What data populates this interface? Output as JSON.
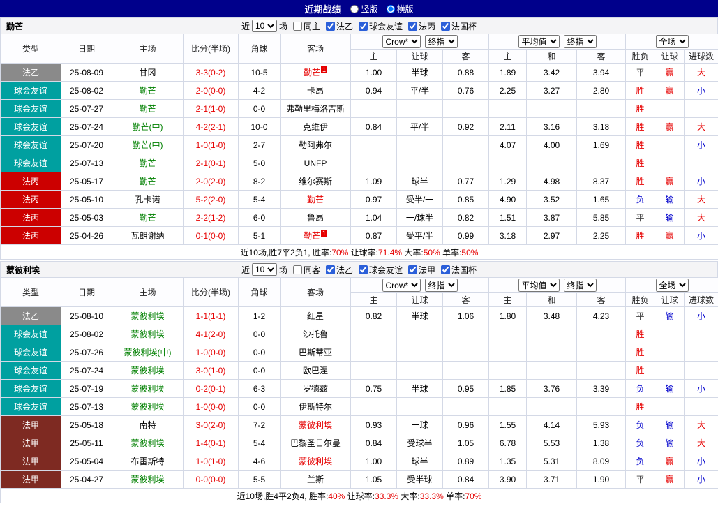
{
  "colors": {
    "topbar_bg": "#00008B",
    "red": "#E60000",
    "blue": "#0000CC",
    "green": "#008000",
    "dark": "#444444"
  },
  "topbar": {
    "title": "近期战绩",
    "options": [
      {
        "label": "竖版",
        "checked": false
      },
      {
        "label": "横版",
        "checked": true
      }
    ]
  },
  "shared": {
    "near_label": "近",
    "games_label": "场",
    "match_count": "10",
    "col_headers": [
      "类型",
      "日期",
      "主场",
      "比分(半场)",
      "角球",
      "客场"
    ],
    "sub_headers": [
      "主",
      "让球",
      "客",
      "主",
      "和",
      "客",
      "胜负",
      "让球",
      "进球数"
    ],
    "selects": {
      "asia_source": "Crow*",
      "asia_time": "终指",
      "europe_source": "平均值",
      "europe_time": "终指",
      "scope": "全场"
    },
    "league_colors": {
      "法乙": "#8A8A8A",
      "球会友谊": "#00A0A0",
      "法丙": "#CC0000",
      "法甲": "#7E2A22"
    }
  },
  "tables": [
    {
      "team": "勤芒",
      "filter": {
        "same_label": "同主",
        "same_checked": false,
        "leagues": [
          {
            "label": "法乙",
            "checked": true
          },
          {
            "label": "球会友谊",
            "checked": true
          },
          {
            "label": "法丙",
            "checked": true
          },
          {
            "label": "法国杯",
            "checked": true
          }
        ]
      },
      "rows": [
        {
          "league": "法乙",
          "date": "25-08-09",
          "home": {
            "name": "甘冈",
            "color": "black"
          },
          "score": "3-3(0-2)",
          "corner": "10-5",
          "away": {
            "name": "勤芒",
            "color": "red",
            "badge": "1"
          },
          "asia": [
            "1.00",
            "半球",
            "0.88"
          ],
          "europe": [
            "1.89",
            "3.42",
            "3.94"
          ],
          "results": [
            {
              "t": "平",
              "c": "dark"
            },
            {
              "t": "赢",
              "c": "red"
            },
            {
              "t": "大",
              "c": "red"
            }
          ]
        },
        {
          "league": "球会友谊",
          "date": "25-08-02",
          "home": {
            "name": "勤芒",
            "color": "green"
          },
          "score": "2-0(0-0)",
          "corner": "4-2",
          "away": {
            "name": "卡昂",
            "color": "black"
          },
          "asia": [
            "0.94",
            "平/半",
            "0.76"
          ],
          "europe": [
            "2.25",
            "3.27",
            "2.80"
          ],
          "results": [
            {
              "t": "胜",
              "c": "red"
            },
            {
              "t": "赢",
              "c": "red"
            },
            {
              "t": "小",
              "c": "blue"
            }
          ]
        },
        {
          "league": "球会友谊",
          "date": "25-07-27",
          "home": {
            "name": "勤芒",
            "color": "green"
          },
          "score": "2-1(1-0)",
          "corner": "0-0",
          "away": {
            "name": "弗勒里梅洛吉斯",
            "color": "black"
          },
          "asia": [
            "",
            "",
            ""
          ],
          "europe": [
            "",
            "",
            ""
          ],
          "results": [
            {
              "t": "胜",
              "c": "red"
            },
            {
              "t": ""
            },
            {
              "t": ""
            }
          ]
        },
        {
          "league": "球会友谊",
          "date": "25-07-24",
          "home": {
            "name": "勤芒(中)",
            "color": "green"
          },
          "score": "4-2(2-1)",
          "corner": "10-0",
          "away": {
            "name": "克维伊",
            "color": "black"
          },
          "asia": [
            "0.84",
            "平/半",
            "0.92"
          ],
          "europe": [
            "2.11",
            "3.16",
            "3.18"
          ],
          "results": [
            {
              "t": "胜",
              "c": "red"
            },
            {
              "t": "赢",
              "c": "red"
            },
            {
              "t": "大",
              "c": "red"
            }
          ]
        },
        {
          "league": "球会友谊",
          "date": "25-07-20",
          "home": {
            "name": "勤芒(中)",
            "color": "green"
          },
          "score": "1-0(1-0)",
          "corner": "2-7",
          "away": {
            "name": "勒阿弗尔",
            "color": "black"
          },
          "asia": [
            "",
            "",
            ""
          ],
          "europe": [
            "4.07",
            "4.00",
            "1.69"
          ],
          "results": [
            {
              "t": "胜",
              "c": "red"
            },
            {
              "t": ""
            },
            {
              "t": "小",
              "c": "blue"
            }
          ]
        },
        {
          "league": "球会友谊",
          "date": "25-07-13",
          "home": {
            "name": "勤芒",
            "color": "green"
          },
          "score": "2-1(0-1)",
          "corner": "5-0",
          "away": {
            "name": "UNFP",
            "color": "black"
          },
          "asia": [
            "",
            "",
            ""
          ],
          "europe": [
            "",
            "",
            ""
          ],
          "results": [
            {
              "t": "胜",
              "c": "red"
            },
            {
              "t": ""
            },
            {
              "t": ""
            }
          ]
        },
        {
          "league": "法丙",
          "date": "25-05-17",
          "home": {
            "name": "勤芒",
            "color": "green"
          },
          "score": "2-0(2-0)",
          "corner": "8-2",
          "away": {
            "name": "维尔赛斯",
            "color": "black"
          },
          "asia": [
            "1.09",
            "球半",
            "0.77"
          ],
          "europe": [
            "1.29",
            "4.98",
            "8.37"
          ],
          "results": [
            {
              "t": "胜",
              "c": "red"
            },
            {
              "t": "赢",
              "c": "red"
            },
            {
              "t": "小",
              "c": "blue"
            }
          ]
        },
        {
          "league": "法丙",
          "date": "25-05-10",
          "home": {
            "name": "孔卡诺",
            "color": "black"
          },
          "score": "5-2(2-0)",
          "corner": "5-4",
          "away": {
            "name": "勤芒",
            "color": "red"
          },
          "asia": [
            "0.97",
            "受半/一",
            "0.85"
          ],
          "europe": [
            "4.90",
            "3.52",
            "1.65"
          ],
          "results": [
            {
              "t": "负",
              "c": "blue"
            },
            {
              "t": "输",
              "c": "blue"
            },
            {
              "t": "大",
              "c": "red"
            }
          ]
        },
        {
          "league": "法丙",
          "date": "25-05-03",
          "home": {
            "name": "勤芒",
            "color": "green"
          },
          "score": "2-2(1-2)",
          "corner": "6-0",
          "away": {
            "name": "鲁昂",
            "color": "black"
          },
          "asia": [
            "1.04",
            "一/球半",
            "0.82"
          ],
          "europe": [
            "1.51",
            "3.87",
            "5.85"
          ],
          "results": [
            {
              "t": "平",
              "c": "dark"
            },
            {
              "t": "输",
              "c": "blue"
            },
            {
              "t": "大",
              "c": "red"
            }
          ]
        },
        {
          "league": "法丙",
          "date": "25-04-26",
          "home": {
            "name": "瓦朗谢纳",
            "color": "black"
          },
          "score": "0-1(0-0)",
          "corner": "5-1",
          "away": {
            "name": "勤芒",
            "color": "red",
            "badge": "1"
          },
          "asia": [
            "0.87",
            "受平/半",
            "0.99"
          ],
          "europe": [
            "3.18",
            "2.97",
            "2.25"
          ],
          "results": [
            {
              "t": "胜",
              "c": "red"
            },
            {
              "t": "赢",
              "c": "red"
            },
            {
              "t": "小",
              "c": "blue"
            }
          ]
        }
      ],
      "summary": [
        {
          "t": "近10场,胜7平2负1, 胜率:"
        },
        {
          "t": "70%",
          "c": "red"
        },
        {
          "t": " 让球率:"
        },
        {
          "t": "71.4%",
          "c": "red"
        },
        {
          "t": " 大率:"
        },
        {
          "t": "50%",
          "c": "red"
        },
        {
          "t": " 单率:"
        },
        {
          "t": "50%",
          "c": "red"
        }
      ]
    },
    {
      "team": "蒙彼利埃",
      "filter": {
        "same_label": "同客",
        "same_checked": false,
        "leagues": [
          {
            "label": "法乙",
            "checked": true
          },
          {
            "label": "球会友谊",
            "checked": true
          },
          {
            "label": "法甲",
            "checked": true
          },
          {
            "label": "法国杯",
            "checked": true
          }
        ]
      },
      "rows": [
        {
          "league": "法乙",
          "date": "25-08-10",
          "home": {
            "name": "蒙彼利埃",
            "color": "green"
          },
          "score": "1-1(1-1)",
          "corner": "1-2",
          "away": {
            "name": "红星",
            "color": "black"
          },
          "asia": [
            "0.82",
            "半球",
            "1.06"
          ],
          "europe": [
            "1.80",
            "3.48",
            "4.23"
          ],
          "results": [
            {
              "t": "平",
              "c": "dark"
            },
            {
              "t": "输",
              "c": "blue"
            },
            {
              "t": "小",
              "c": "blue"
            }
          ]
        },
        {
          "league": "球会友谊",
          "date": "25-08-02",
          "home": {
            "name": "蒙彼利埃",
            "color": "green"
          },
          "score": "4-1(2-0)",
          "corner": "0-0",
          "away": {
            "name": "沙托鲁",
            "color": "black"
          },
          "asia": [
            "",
            "",
            ""
          ],
          "europe": [
            "",
            "",
            ""
          ],
          "results": [
            {
              "t": "胜",
              "c": "red"
            },
            {
              "t": ""
            },
            {
              "t": ""
            }
          ]
        },
        {
          "league": "球会友谊",
          "date": "25-07-26",
          "home": {
            "name": "蒙彼利埃(中)",
            "color": "green"
          },
          "score": "1-0(0-0)",
          "corner": "0-0",
          "away": {
            "name": "巴斯蒂亚",
            "color": "black"
          },
          "asia": [
            "",
            "",
            ""
          ],
          "europe": [
            "",
            "",
            ""
          ],
          "results": [
            {
              "t": "胜",
              "c": "red"
            },
            {
              "t": ""
            },
            {
              "t": ""
            }
          ]
        },
        {
          "league": "球会友谊",
          "date": "25-07-24",
          "home": {
            "name": "蒙彼利埃",
            "color": "green"
          },
          "score": "3-0(1-0)",
          "corner": "0-0",
          "away": {
            "name": "欧巴涅",
            "color": "black"
          },
          "asia": [
            "",
            "",
            ""
          ],
          "europe": [
            "",
            "",
            ""
          ],
          "results": [
            {
              "t": "胜",
              "c": "red"
            },
            {
              "t": ""
            },
            {
              "t": ""
            }
          ]
        },
        {
          "league": "球会友谊",
          "date": "25-07-19",
          "home": {
            "name": "蒙彼利埃",
            "color": "green"
          },
          "score": "0-2(0-1)",
          "corner": "6-3",
          "away": {
            "name": "罗德兹",
            "color": "black"
          },
          "asia": [
            "0.75",
            "半球",
            "0.95"
          ],
          "europe": [
            "1.85",
            "3.76",
            "3.39"
          ],
          "results": [
            {
              "t": "负",
              "c": "blue"
            },
            {
              "t": "输",
              "c": "blue"
            },
            {
              "t": "小",
              "c": "blue"
            }
          ]
        },
        {
          "league": "球会友谊",
          "date": "25-07-13",
          "home": {
            "name": "蒙彼利埃",
            "color": "green"
          },
          "score": "1-0(0-0)",
          "corner": "0-0",
          "away": {
            "name": "伊斯特尔",
            "color": "black"
          },
          "asia": [
            "",
            "",
            ""
          ],
          "europe": [
            "",
            "",
            ""
          ],
          "results": [
            {
              "t": "胜",
              "c": "red"
            },
            {
              "t": ""
            },
            {
              "t": ""
            }
          ]
        },
        {
          "league": "法甲",
          "date": "25-05-18",
          "home": {
            "name": "南特",
            "color": "black"
          },
          "score": "3-0(2-0)",
          "corner": "7-2",
          "away": {
            "name": "蒙彼利埃",
            "color": "red"
          },
          "asia": [
            "0.93",
            "一球",
            "0.96"
          ],
          "europe": [
            "1.55",
            "4.14",
            "5.93"
          ],
          "results": [
            {
              "t": "负",
              "c": "blue"
            },
            {
              "t": "输",
              "c": "blue"
            },
            {
              "t": "大",
              "c": "red"
            }
          ]
        },
        {
          "league": "法甲",
          "date": "25-05-11",
          "home": {
            "name": "蒙彼利埃",
            "color": "green"
          },
          "score": "1-4(0-1)",
          "corner": "5-4",
          "away": {
            "name": "巴黎圣日尔曼",
            "color": "black"
          },
          "asia": [
            "0.84",
            "受球半",
            "1.05"
          ],
          "europe": [
            "6.78",
            "5.53",
            "1.38"
          ],
          "results": [
            {
              "t": "负",
              "c": "blue"
            },
            {
              "t": "输",
              "c": "blue"
            },
            {
              "t": "大",
              "c": "red"
            }
          ]
        },
        {
          "league": "法甲",
          "date": "25-05-04",
          "home": {
            "name": "布雷斯特",
            "color": "black"
          },
          "score": "1-0(1-0)",
          "corner": "4-6",
          "away": {
            "name": "蒙彼利埃",
            "color": "red"
          },
          "asia": [
            "1.00",
            "球半",
            "0.89"
          ],
          "europe": [
            "1.35",
            "5.31",
            "8.09"
          ],
          "results": [
            {
              "t": "负",
              "c": "blue"
            },
            {
              "t": "赢",
              "c": "red"
            },
            {
              "t": "小",
              "c": "blue"
            }
          ]
        },
        {
          "league": "法甲",
          "date": "25-04-27",
          "home": {
            "name": "蒙彼利埃",
            "color": "green"
          },
          "score": "0-0(0-0)",
          "corner": "5-5",
          "away": {
            "name": "兰斯",
            "color": "black"
          },
          "asia": [
            "1.05",
            "受半球",
            "0.84"
          ],
          "europe": [
            "3.90",
            "3.71",
            "1.90"
          ],
          "results": [
            {
              "t": "平",
              "c": "dark"
            },
            {
              "t": "赢",
              "c": "red"
            },
            {
              "t": "小",
              "c": "blue"
            }
          ]
        }
      ],
      "summary": [
        {
          "t": "近10场,胜4平2负4, 胜率:"
        },
        {
          "t": "40%",
          "c": "red"
        },
        {
          "t": " 让球率:"
        },
        {
          "t": "33.3%",
          "c": "red"
        },
        {
          "t": " 大率:"
        },
        {
          "t": "33.3%",
          "c": "red"
        },
        {
          "t": " 单率:"
        },
        {
          "t": "70%",
          "c": "red"
        }
      ]
    }
  ]
}
